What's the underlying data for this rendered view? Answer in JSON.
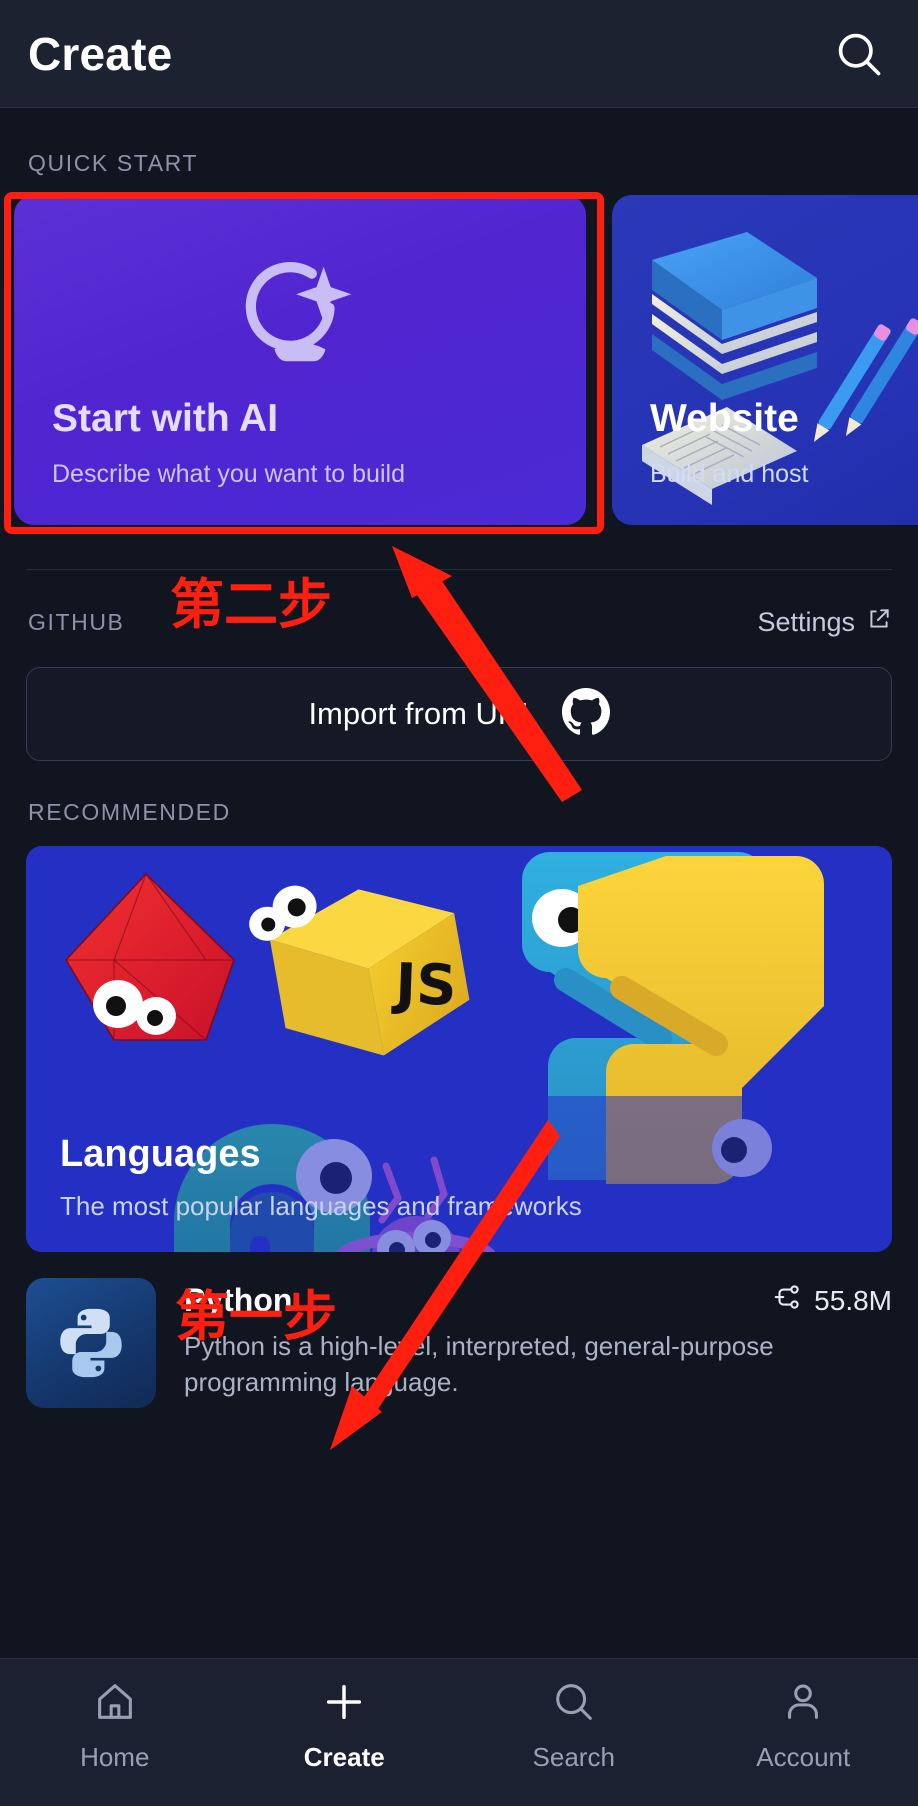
{
  "header": {
    "title": "Create",
    "search_icon": "search-icon"
  },
  "quick_start": {
    "label": "QUICK START",
    "cards": [
      {
        "title": "Start with AI",
        "subtitle": "Describe what you want to build",
        "icon": "ai-sphere-sparkle-icon"
      },
      {
        "title": "Website",
        "subtitle": "Build and host",
        "icon": "isometric-books-icon"
      }
    ]
  },
  "github": {
    "label": "GITHUB",
    "settings_label": "Settings",
    "settings_icon": "external-link-icon",
    "import_label": "Import from URL",
    "import_icon": "github-icon"
  },
  "recommended": {
    "label": "RECOMMENDED",
    "feature_card": {
      "title": "Languages",
      "subtitle": "The most popular languages and frameworks"
    },
    "items": [
      {
        "name": "Python",
        "description": "Python is a high-level, interpreted, general-purpose programming language.",
        "forks": "55.8M",
        "forks_icon": "fork-icon",
        "thumb_icon": "python-icon"
      }
    ]
  },
  "bottom_nav": {
    "items": [
      {
        "label": "Home",
        "icon": "home-icon",
        "active": false
      },
      {
        "label": "Create",
        "icon": "plus-icon",
        "active": true
      },
      {
        "label": "Search",
        "icon": "search-icon",
        "active": false
      },
      {
        "label": "Account",
        "icon": "person-icon",
        "active": false
      }
    ]
  },
  "annotations": {
    "color": "#ff1f10",
    "step_two_text": "第二步",
    "step_one_text": "第一步"
  }
}
